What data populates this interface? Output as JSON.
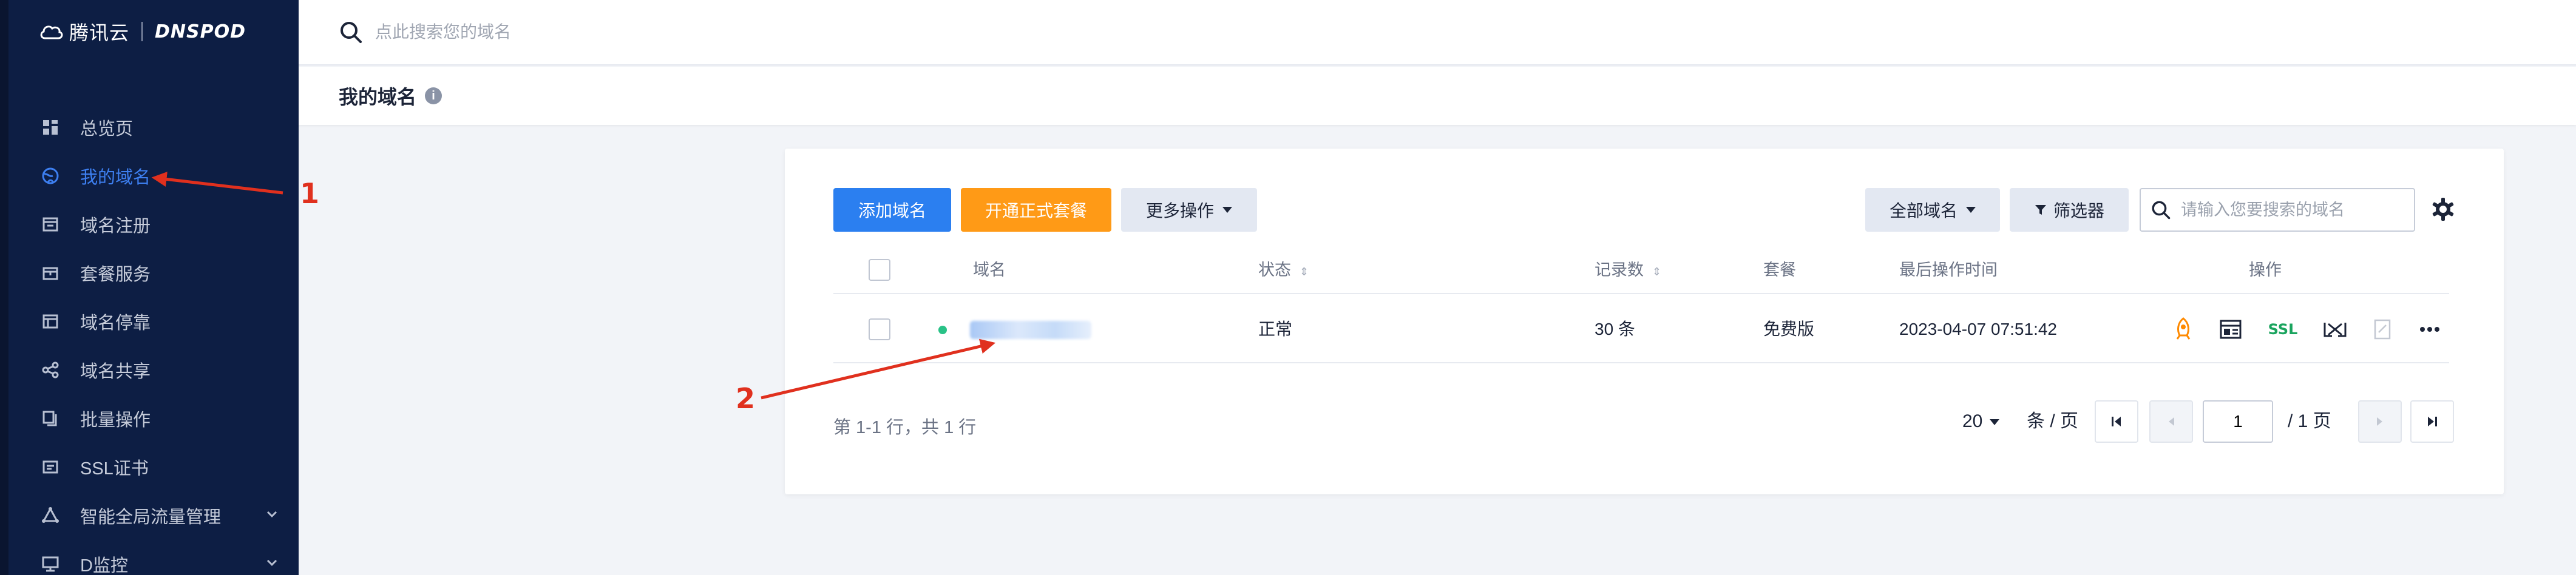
{
  "logo": {
    "name": "腾讯云",
    "brand": "DNSPOD"
  },
  "sidebar": {
    "items": [
      {
        "label": "总览页",
        "icon": "dashboard-icon"
      },
      {
        "label": "我的域名",
        "icon": "globe-icon",
        "active": true
      },
      {
        "label": "域名注册",
        "icon": "registration-icon"
      },
      {
        "label": "套餐服务",
        "icon": "package-icon"
      },
      {
        "label": "域名停靠",
        "icon": "parking-icon"
      },
      {
        "label": "域名共享",
        "icon": "share-icon"
      },
      {
        "label": "批量操作",
        "icon": "batch-icon"
      },
      {
        "label": "SSL证书",
        "icon": "certificate-icon"
      },
      {
        "label": "智能全局流量管理",
        "icon": "traffic-icon",
        "expandable": true
      },
      {
        "label": "D监控",
        "icon": "monitor-icon",
        "expandable": true
      }
    ]
  },
  "topbar": {
    "search_placeholder": "点此搜索您的域名"
  },
  "page": {
    "title": "我的域名",
    "info_icon": "i"
  },
  "toolbar": {
    "add_domain": "添加域名",
    "open_plan": "开通正式套餐",
    "more_actions": "更多操作",
    "all_domains": "全部域名",
    "filter": "筛选器",
    "search_placeholder": "请输入您要搜索的域名"
  },
  "table": {
    "headers": {
      "domain": "域名",
      "status": "状态",
      "records": "记录数",
      "plan": "套餐",
      "last_op": "最后操作时间",
      "actions": "操作"
    },
    "rows": [
      {
        "domain": "",
        "status": "正常",
        "records": "30 条",
        "plan": "免费版",
        "last_op": "2023-04-07 07:51:42",
        "ssl": "SSL"
      }
    ]
  },
  "pagination": {
    "summary": "第 1-1 行，共 1 行",
    "page_size": "20",
    "per_page": "条 / 页",
    "current": "1",
    "total": "/ 1 页"
  },
  "annotations": {
    "one": "1",
    "two": "2"
  },
  "colors": {
    "sidebar_bg": "#0d1e44",
    "accent": "#2b7ff0",
    "orange": "#ff9a16",
    "annotation": "#e0301e",
    "status_ok": "#29c287"
  }
}
